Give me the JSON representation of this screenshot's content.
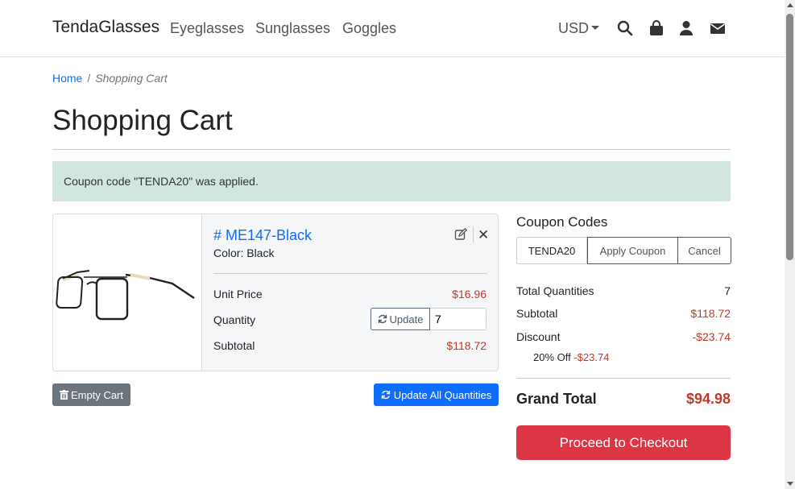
{
  "nav": {
    "brand": "TendaGlasses",
    "links": [
      "Eyeglasses",
      "Sunglasses",
      "Goggles"
    ],
    "currency": "USD",
    "icons": [
      "search-icon",
      "bag-icon",
      "user-icon",
      "envelope-icon"
    ]
  },
  "breadcrumb": {
    "home": "Home",
    "separator": "/",
    "current": "Shopping Cart"
  },
  "page": {
    "title": "Shopping Cart"
  },
  "alert": {
    "message": "Coupon code \"TENDA20\" was applied."
  },
  "cart": {
    "item": {
      "sku": "# ME147-Black",
      "color": "Color: Black",
      "unit_price_label": "Unit Price",
      "unit_price": "$16.96",
      "quantity_label": "Quantity",
      "update_label": "Update",
      "quantity": "7",
      "subtotal_label": "Subtotal",
      "subtotal": "$118.72"
    },
    "empty_label": "Empty Cart",
    "update_all_label": "Update All Quantities"
  },
  "summary": {
    "coupon_title": "Coupon Codes",
    "coupon_code": "TENDA20",
    "apply_label": "Apply Coupon",
    "cancel_label": "Cancel",
    "total_qty_label": "Total Quantities",
    "total_qty": "7",
    "subtotal_label": "Subtotal",
    "subtotal": "$118.72",
    "discount_label": "Discount",
    "discount": "-$23.74",
    "discount_detail_name": "20% Off",
    "discount_detail_value": "-$23.74",
    "grand_label": "Grand Total",
    "grand_value": "$94.98",
    "checkout_label": "Proceed to Checkout"
  },
  "colors": {
    "primary": "#0d6efd",
    "danger": "#dc3545",
    "price": "#c0392b",
    "alert_bg": "#d1e7dd",
    "secondary": "#6c757d"
  }
}
